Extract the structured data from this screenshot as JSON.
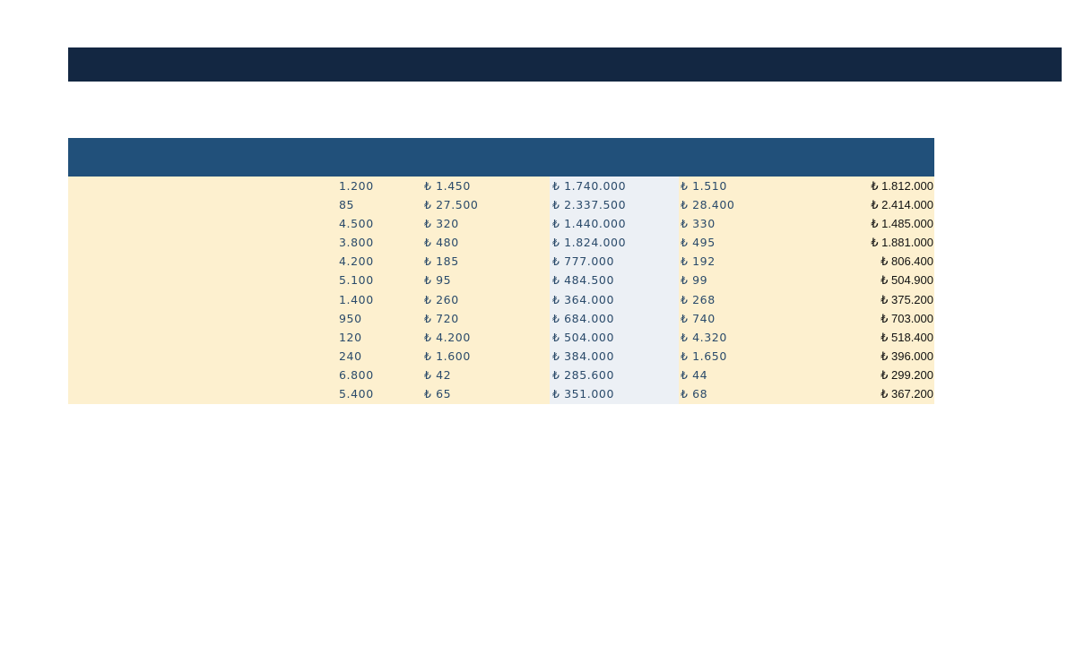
{
  "sheet": {
    "rows": [
      {
        "qty": "1.200",
        "price": "₺ 1.450",
        "total": "₺ 1.740.000",
        "new_price": "₺ 1.510",
        "new_total": "₺ 1.812.000"
      },
      {
        "qty": "85",
        "price": "₺ 27.500",
        "total": "₺ 2.337.500",
        "new_price": "₺ 28.400",
        "new_total": "₺ 2.414.000"
      },
      {
        "qty": "4.500",
        "price": "₺ 320",
        "total": "₺ 1.440.000",
        "new_price": "₺ 330",
        "new_total": "₺ 1.485.000"
      },
      {
        "qty": "3.800",
        "price": "₺ 480",
        "total": "₺ 1.824.000",
        "new_price": "₺ 495",
        "new_total": "₺ 1.881.000"
      },
      {
        "qty": "4.200",
        "price": "₺ 185",
        "total": "₺ 777.000",
        "new_price": "₺ 192",
        "new_total": "₺ 806.400"
      },
      {
        "qty": "5.100",
        "price": "₺ 95",
        "total": "₺ 484.500",
        "new_price": "₺ 99",
        "new_total": "₺ 504.900"
      },
      {
        "qty": "1.400",
        "price": "₺ 260",
        "total": "₺ 364.000",
        "new_price": "₺ 268",
        "new_total": "₺ 375.200"
      },
      {
        "qty": "950",
        "price": "₺ 720",
        "total": "₺ 684.000",
        "new_price": "₺ 740",
        "new_total": "₺ 703.000"
      },
      {
        "qty": "120",
        "price": "₺ 4.200",
        "total": "₺ 504.000",
        "new_price": "₺ 4.320",
        "new_total": "₺ 518.400"
      },
      {
        "qty": "240",
        "price": "₺ 1.600",
        "total": "₺ 384.000",
        "new_price": "₺ 1.650",
        "new_total": "₺ 396.000"
      },
      {
        "qty": "6.800",
        "price": "₺ 42",
        "total": "₺ 285.600",
        "new_price": "₺ 44",
        "new_total": "₺ 299.200"
      },
      {
        "qty": "5.400",
        "price": "₺ 65",
        "total": "₺ 351.000",
        "new_price": "₺ 68",
        "new_total": "₺ 367.200"
      }
    ]
  },
  "colors": {
    "title_bar": "#132742",
    "header_row": "#21507a",
    "row_fill": "#fdf0cf",
    "highlight_column": "#ecf0f5",
    "cell_text": "#2a4a6a",
    "result_text": "#111111"
  }
}
